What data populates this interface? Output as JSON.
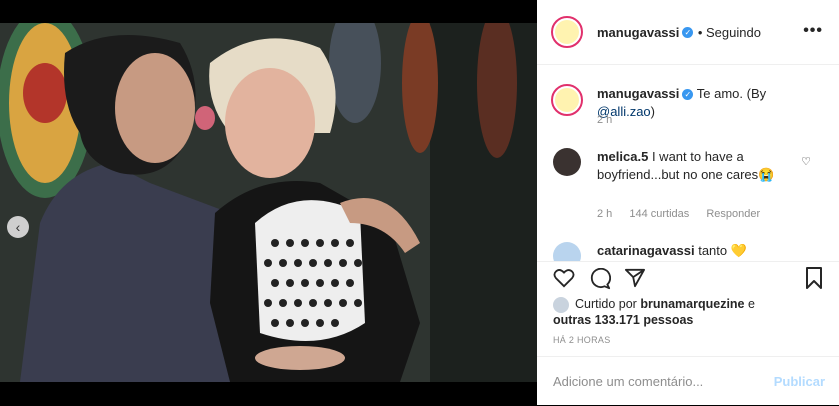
{
  "post": {
    "author": "manugavassi",
    "follow_status": "Seguindo",
    "caption_text": "Te amo. (By ",
    "caption_mention": "@alli.zao",
    "caption_close": ")",
    "caption_time": "2 h",
    "more_icon": "•••",
    "prev_icon": "‹"
  },
  "comments": [
    {
      "user": "melica.5",
      "text": "I want to have a boyfriend...but no one cares😭",
      "time": "2 h",
      "likes": "144 curtidas",
      "reply": "Responder"
    },
    {
      "user": "catarinagavassi",
      "text": "tanto 💛"
    }
  ],
  "likes": {
    "prefix": "Curtido por ",
    "user": "brunamarquezine",
    "mid": " e",
    "others": "outras 133.171 pessoas"
  },
  "timestamp": "HÁ 2 HORAS",
  "add_comment": {
    "placeholder": "Adicione um comentário...",
    "publish": "Publicar"
  },
  "colors": {
    "verified": "#3897f0",
    "link": "#00376b",
    "story_ring": "#e1306c",
    "publish_disabled": "#b3dbff"
  }
}
